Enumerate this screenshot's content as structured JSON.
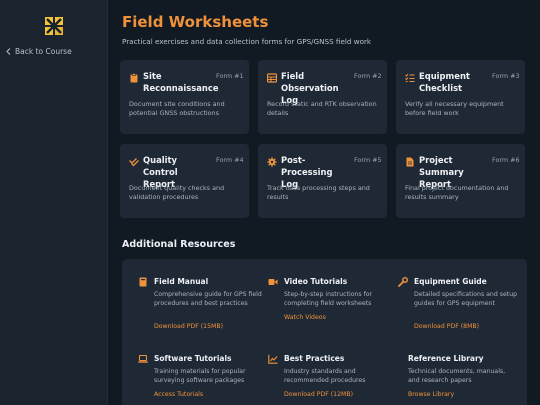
{
  "sidebar": {
    "back_label": "Back to Course"
  },
  "header": {
    "title": "Field Worksheets",
    "subtitle": "Practical exercises and data collection forms for GPS/GNSS field work"
  },
  "worksheets": [
    {
      "title": "Site Reconnaissance",
      "form": "Form #1",
      "desc": "Document site conditions and potential GNSS obstructions",
      "icon": "clipboard-icon"
    },
    {
      "title": "Field Observation Log",
      "form": "Form #2",
      "desc": "Record static and RTK observation details",
      "icon": "table-icon"
    },
    {
      "title": "Equipment Checklist",
      "form": "Form #3",
      "desc": "Verify all necessary equipment before field work",
      "icon": "checklist-icon"
    },
    {
      "title": "Quality Control Report",
      "form": "Form #4",
      "desc": "Document quality checks and validation procedures",
      "icon": "check-double-icon"
    },
    {
      "title": "Post-Processing Log",
      "form": "Form #5",
      "desc": "Track data processing steps and results",
      "icon": "gear-icon"
    },
    {
      "title": "Project Summary Report",
      "form": "Form #6",
      "desc": "Final project documentation and results summary",
      "icon": "document-icon"
    }
  ],
  "resources": {
    "title": "Additional Resources",
    "items": [
      {
        "title": "Field Manual",
        "desc": "Comprehensive guide for GPS field procedures and best practices",
        "link": "Download PDF (15MB)",
        "icon": "book-icon"
      },
      {
        "title": "Video Tutorials",
        "desc": "Step-by-step instructions for completing field worksheets",
        "link": "Watch Videos",
        "icon": "video-icon"
      },
      {
        "title": "Equipment Guide",
        "desc": "Detailed specifications and setup guides for GPS equipment",
        "link": "Download PDF (8MB)",
        "icon": "wrench-icon"
      },
      {
        "title": "Software Tutorials",
        "desc": "Training materials for popular surveying software packages",
        "link": "Access Tutorials",
        "icon": "laptop-icon"
      },
      {
        "title": "Best Practices",
        "desc": "Industry standards and recommended procedures",
        "link": "Download PDF (12MB)",
        "icon": "chart-line-icon"
      },
      {
        "title": "Reference Library",
        "desc": "Technical documents, manuals, and research papers",
        "link": "Browse Library",
        "icon": ""
      }
    ]
  },
  "colors": {
    "accent": "#f0923a",
    "background": "#111923",
    "card": "#1f2935",
    "sidebar": "#1a232e"
  }
}
